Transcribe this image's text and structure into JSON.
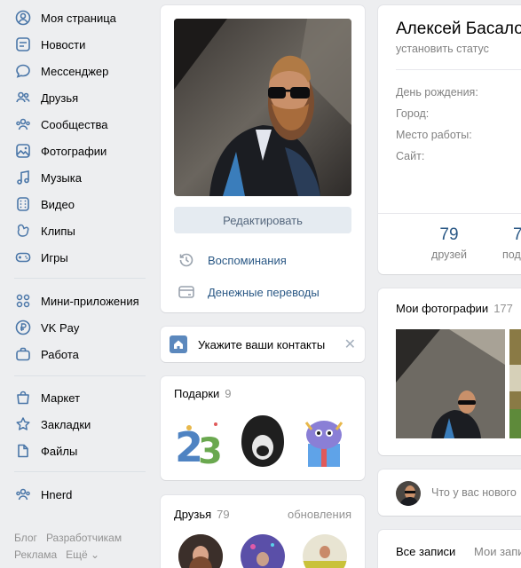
{
  "sidebar": {
    "items": [
      {
        "label": "Моя страница",
        "icon": "user-circle-icon"
      },
      {
        "label": "Новости",
        "icon": "news-icon"
      },
      {
        "label": "Мессенджер",
        "icon": "message-icon"
      },
      {
        "label": "Друзья",
        "icon": "friends-icon"
      },
      {
        "label": "Сообщества",
        "icon": "communities-icon"
      },
      {
        "label": "Фотографии",
        "icon": "photo-icon"
      },
      {
        "label": "Музыка",
        "icon": "music-icon"
      },
      {
        "label": "Видео",
        "icon": "video-icon"
      },
      {
        "label": "Клипы",
        "icon": "clips-icon"
      },
      {
        "label": "Игры",
        "icon": "gamepad-icon"
      },
      {
        "label": "Мини-приложения",
        "icon": "apps-icon"
      },
      {
        "label": "VK Pay",
        "icon": "ruble-icon"
      },
      {
        "label": "Работа",
        "icon": "briefcase-icon"
      },
      {
        "label": "Маркет",
        "icon": "bag-icon"
      },
      {
        "label": "Закладки",
        "icon": "star-icon"
      },
      {
        "label": "Файлы",
        "icon": "file-icon"
      },
      {
        "label": "Hnerd",
        "icon": "group-icon"
      }
    ],
    "footer": {
      "blog": "Блог",
      "developers": "Разработчикам",
      "ads": "Реклама",
      "more": "Ещё ⌄"
    }
  },
  "profile": {
    "edit_label": "Редактировать",
    "memories_label": "Воспоминания",
    "transfers_label": "Денежные переводы",
    "contacts_label": "Укажите ваши контакты",
    "gifts_title": "Подарки",
    "gifts_count": "9",
    "friends_title": "Друзья",
    "friends_count": "79",
    "friends_updates": "обновления"
  },
  "info": {
    "name": "Алексей Басало",
    "status": "установить статус",
    "fields": [
      "День рождения:",
      "Город:",
      "Место работы:",
      "Сайт:"
    ],
    "counter_value": "79",
    "counter_label": "друзей",
    "counter2_value": "7",
    "counter2_label": "подп"
  },
  "photos": {
    "title": "Мои фотографии",
    "count": "177"
  },
  "composer": {
    "placeholder": "Что у вас нового"
  },
  "wall": {
    "tab_all": "Все записи",
    "tab_mine": "Мои запи"
  },
  "colors": {
    "accent": "#4a76a8",
    "link": "#2a5885",
    "background": "#edeef0"
  }
}
